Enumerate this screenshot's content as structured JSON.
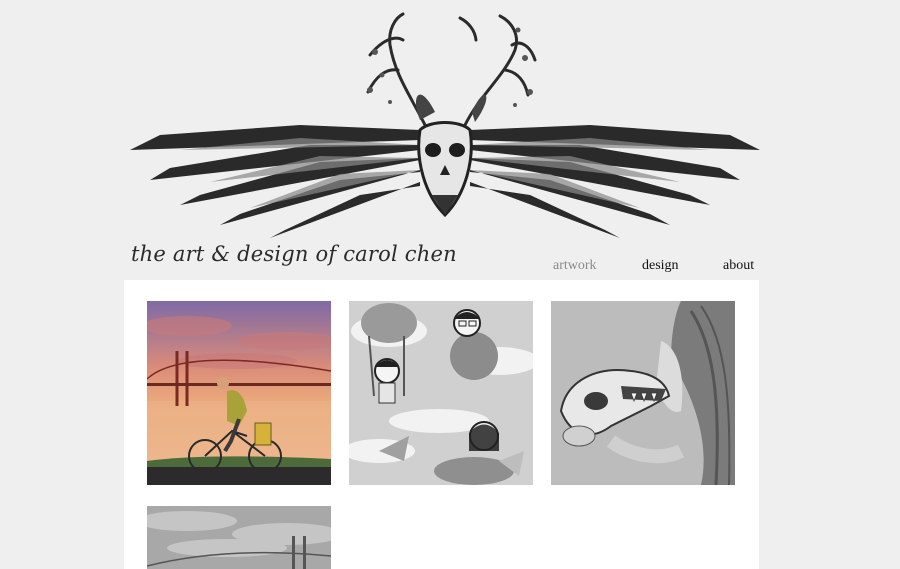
{
  "site": {
    "title": "the art & design of carol chen"
  },
  "nav": {
    "items": [
      {
        "label": "artwork",
        "active": true
      },
      {
        "label": "design",
        "active": false
      },
      {
        "label": "about",
        "active": false
      }
    ]
  },
  "gallery": {
    "items": [
      {
        "subject": "golden-gate-cyclist-painting",
        "tone": "color"
      },
      {
        "subject": "floating-characters-illustration",
        "tone": "grayscale"
      },
      {
        "subject": "wolf-skull-portrait-illustration",
        "tone": "grayscale"
      },
      {
        "subject": "golden-gate-grayscale-painting",
        "tone": "grayscale"
      }
    ]
  },
  "colors": {
    "page_background": "#efefef",
    "gallery_background": "#ffffff",
    "nav_active": "#8a8a8a",
    "nav_default": "#111111"
  }
}
